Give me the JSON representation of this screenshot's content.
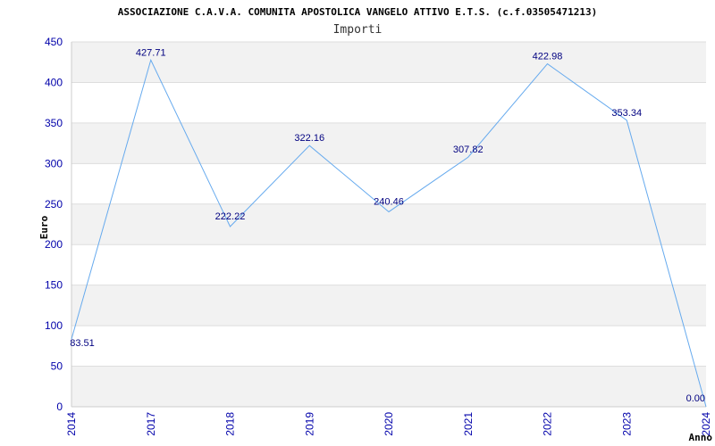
{
  "chart_data": {
    "type": "line",
    "title": "ASSOCIAZIONE C.A.V.A. COMUNITA APOSTOLICA VANGELO ATTIVO E.T.S. (c.f.03505471213)",
    "subtitle": "Importi",
    "xlabel": "Anno",
    "ylabel": "Euro",
    "categories": [
      "2014",
      "2017",
      "2018",
      "2019",
      "2020",
      "2021",
      "2022",
      "2023",
      "2024"
    ],
    "values": [
      83.51,
      427.71,
      222.22,
      322.16,
      240.46,
      307.82,
      422.98,
      353.34,
      0.0
    ],
    "value_labels": [
      "83.51",
      "427.71",
      "222.22",
      "322.16",
      "240.46",
      "307.82",
      "422.98",
      "353.34",
      "0.00"
    ],
    "ylim": [
      0,
      450
    ],
    "yticks": [
      0,
      50,
      100,
      150,
      200,
      250,
      300,
      350,
      400,
      450
    ],
    "grid": true,
    "legend": "none",
    "colors": {
      "line": "#66aaee",
      "band": "#f2f2f2",
      "grid": "#dddddd",
      "tick_text": "#0000aa",
      "label_text": "#000080"
    }
  }
}
